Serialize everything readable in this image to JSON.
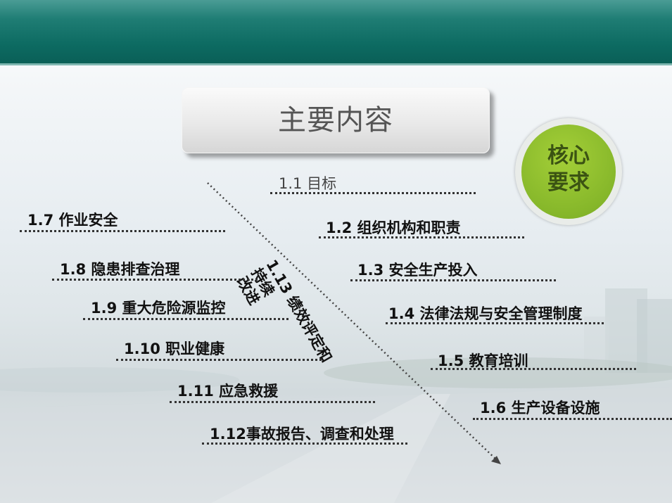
{
  "title": "主要内容",
  "badge": {
    "line1": "核心",
    "line2": "要求"
  },
  "items": [
    {
      "label": "1.1 目标"
    },
    {
      "label": "1.2 组织机构和职责"
    },
    {
      "label": "1.3 安全生产投入"
    },
    {
      "label": "1.4 法律法规与安全管理制度"
    },
    {
      "label": "1.5 教育培训"
    },
    {
      "label": "1.6 生产设备设施"
    },
    {
      "label": "1.7 作业安全"
    },
    {
      "label": "1.8 隐患排查治理"
    },
    {
      "label": "1.9 重大危险源监控"
    },
    {
      "label": "1.10 职业健康"
    },
    {
      "label": "1.11 应急救援"
    },
    {
      "label": "1.12事故报告、调查和处理"
    }
  ],
  "diagonal": {
    "line1": "1.13 绩效评定和持续",
    "line2": "改进"
  },
  "colors": {
    "header": "#0d6b62",
    "badge": "#86b72a"
  }
}
